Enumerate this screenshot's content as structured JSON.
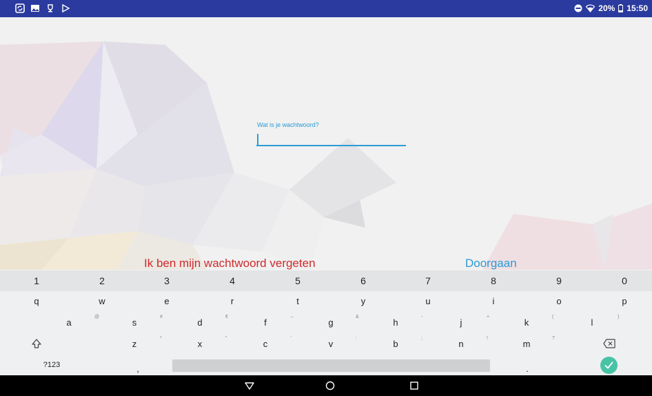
{
  "status_bar": {
    "left_icons": [
      "sync-icon",
      "image-icon",
      "trophy-icon",
      "play-store-icon"
    ],
    "right_icons": [
      "do-not-disturb-icon",
      "wifi-icon",
      "battery-icon"
    ],
    "battery": "20%",
    "time": "15:50",
    "bg_color": "#2b3a9e"
  },
  "login": {
    "password_label": "Wat is je wachtwoord?",
    "password_value": "",
    "forgot_link": "Ik ben mijn wachtwoord vergeten",
    "continue_button": "Doorgaan",
    "accent_color": "#2a9bd7",
    "forgot_color": "#d0292c"
  },
  "keyboard": {
    "number_row": [
      "1",
      "2",
      "3",
      "4",
      "5",
      "6",
      "7",
      "8",
      "9",
      "0"
    ],
    "row1": [
      "q",
      "w",
      "e",
      "r",
      "t",
      "y",
      "u",
      "i",
      "o",
      "p"
    ],
    "row2": [
      "a",
      "s",
      "d",
      "f",
      "g",
      "h",
      "j",
      "k",
      "l"
    ],
    "row2_hints": [
      "@",
      "#",
      "€",
      "–",
      "&",
      "-",
      "+",
      "(",
      ")"
    ],
    "row3": [
      "z",
      "x",
      "c",
      "v",
      "b",
      "n",
      "m"
    ],
    "row3_hints": [
      "*",
      "\"",
      "'",
      ":",
      ";",
      "!",
      "?"
    ],
    "symbols_key": "?123",
    "comma_key": ",",
    "period_key": ".",
    "shift_icon": "shift-icon",
    "backspace_icon": "backspace-icon",
    "enter_icon": "check-icon",
    "enter_color": "#48c4a5"
  },
  "nav_bar": {
    "buttons": [
      "back-icon",
      "home-icon",
      "recents-icon"
    ]
  }
}
